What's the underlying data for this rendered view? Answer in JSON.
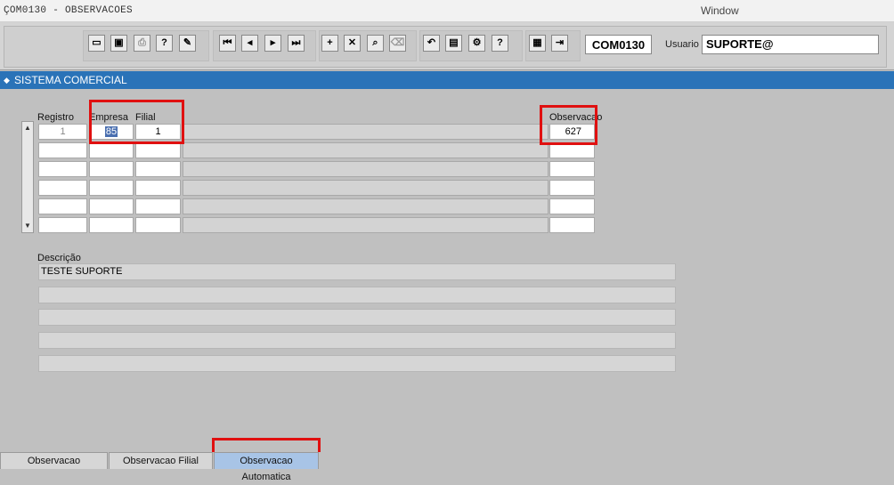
{
  "window": {
    "title": "ÇOM0130 - OBSERVACOES",
    "menu": "Window"
  },
  "toolbar": {
    "buttons": [
      {
        "name": "save-button",
        "glyph": "▭"
      },
      {
        "name": "screen-button",
        "glyph": "▣"
      },
      {
        "name": "print-button",
        "glyph": "⎙"
      },
      {
        "name": "help-query-button",
        "glyph": "?"
      },
      {
        "name": "edit-button",
        "glyph": "✎"
      },
      {
        "name": "first-record-button",
        "glyph": "⏮"
      },
      {
        "name": "prev-record-button",
        "glyph": "◂"
      },
      {
        "name": "next-record-button",
        "glyph": "▸"
      },
      {
        "name": "last-record-button",
        "glyph": "⏭"
      },
      {
        "name": "insert-record-button",
        "glyph": "+"
      },
      {
        "name": "delete-record-button",
        "glyph": "✕"
      },
      {
        "name": "find-button",
        "glyph": "⌕"
      },
      {
        "name": "clear-button",
        "glyph": "⌫"
      },
      {
        "name": "undo-button",
        "glyph": "↶"
      },
      {
        "name": "clipboard-button",
        "glyph": "▤"
      },
      {
        "name": "tools-button",
        "glyph": "⚙"
      },
      {
        "name": "help-button",
        "glyph": "?"
      },
      {
        "name": "calendar-button",
        "glyph": "▦"
      },
      {
        "name": "exit-button",
        "glyph": "⇥"
      }
    ],
    "form_code": "COM0130",
    "user_label": "Usuario",
    "user_value": "SUPORTE@"
  },
  "system_bar": {
    "title": "SISTEMA COMERCIAL"
  },
  "grid": {
    "headers": {
      "registro": "Registro",
      "empresa": "Empresa",
      "filial": "Filial",
      "observacao": "Observacao"
    },
    "rows": [
      {
        "registro": "1",
        "empresa": "85",
        "filial": "1",
        "observacao": "627"
      },
      {
        "registro": "",
        "empresa": "",
        "filial": "",
        "observacao": ""
      },
      {
        "registro": "",
        "empresa": "",
        "filial": "",
        "observacao": ""
      },
      {
        "registro": "",
        "empresa": "",
        "filial": "",
        "observacao": ""
      },
      {
        "registro": "",
        "empresa": "",
        "filial": "",
        "observacao": ""
      },
      {
        "registro": "",
        "empresa": "",
        "filial": "",
        "observacao": ""
      }
    ]
  },
  "description": {
    "label": "Descrição",
    "lines": [
      "TESTE SUPORTE",
      "",
      "",
      "",
      "",
      ""
    ]
  },
  "tabs": [
    {
      "label": "Observacao",
      "active": false
    },
    {
      "label": "Observacao Filial",
      "active": false
    },
    {
      "label": "Observacao Automatica",
      "active": true
    }
  ]
}
